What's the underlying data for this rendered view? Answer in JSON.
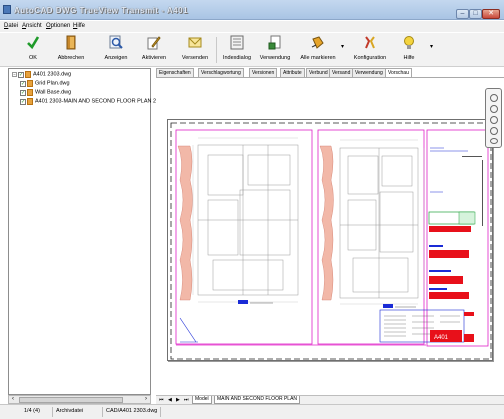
{
  "window": {
    "title": "AutoCAD DWG TrueView Transmit - A401"
  },
  "menu": [
    {
      "label": "Datei"
    },
    {
      "label": "Ansicht"
    },
    {
      "label": "Optionen"
    },
    {
      "label": "Hilfe"
    }
  ],
  "toolbar": {
    "ok": "OK",
    "abbrechen": "Abbrechen",
    "anzeigen": "Anzeigen",
    "aktivieren": "Aktivieren",
    "versenden": "Versenden",
    "indexdialog": "Indexdialog",
    "verwendung": "Verwendung",
    "alle_markieren": "Alle markieren",
    "konfiguration": "Konfiguration",
    "hilfe": "Hilfe"
  },
  "tree": {
    "items": [
      {
        "label": "A401 2303.dwg",
        "level": 0
      },
      {
        "label": "Grid Plan.dwg",
        "level": 1
      },
      {
        "label": "Wall Base.dwg",
        "level": 1
      },
      {
        "label": "A401 2303-MAIN AND SECOND FLOOR PLAN 2",
        "level": 1
      }
    ]
  },
  "tabs": [
    {
      "label": "Eigenschaften"
    },
    {
      "label": "Verschlagwortung"
    },
    {
      "label": "Versionen"
    },
    {
      "label": "Attribute"
    },
    {
      "label": "Verbund"
    },
    {
      "label": "Versand"
    },
    {
      "label": "Verwendung"
    },
    {
      "label": "Vorschau",
      "active": true
    }
  ],
  "layout_tabs": {
    "model": "Model",
    "layout": "MAIN AND SECOND FLOOR PLAN"
  },
  "drawing": {
    "sheet_number": "A401"
  },
  "status": {
    "count": "1/4 (4)",
    "location": "Archivdatei",
    "file": "CAD/A401 2303.dwg"
  },
  "colors": {
    "magenta": "#e020c8",
    "red": "#e8101a",
    "blue": "#1a2bd6",
    "green": "#21a03a",
    "drawing_gray": "#9a9a9a"
  }
}
